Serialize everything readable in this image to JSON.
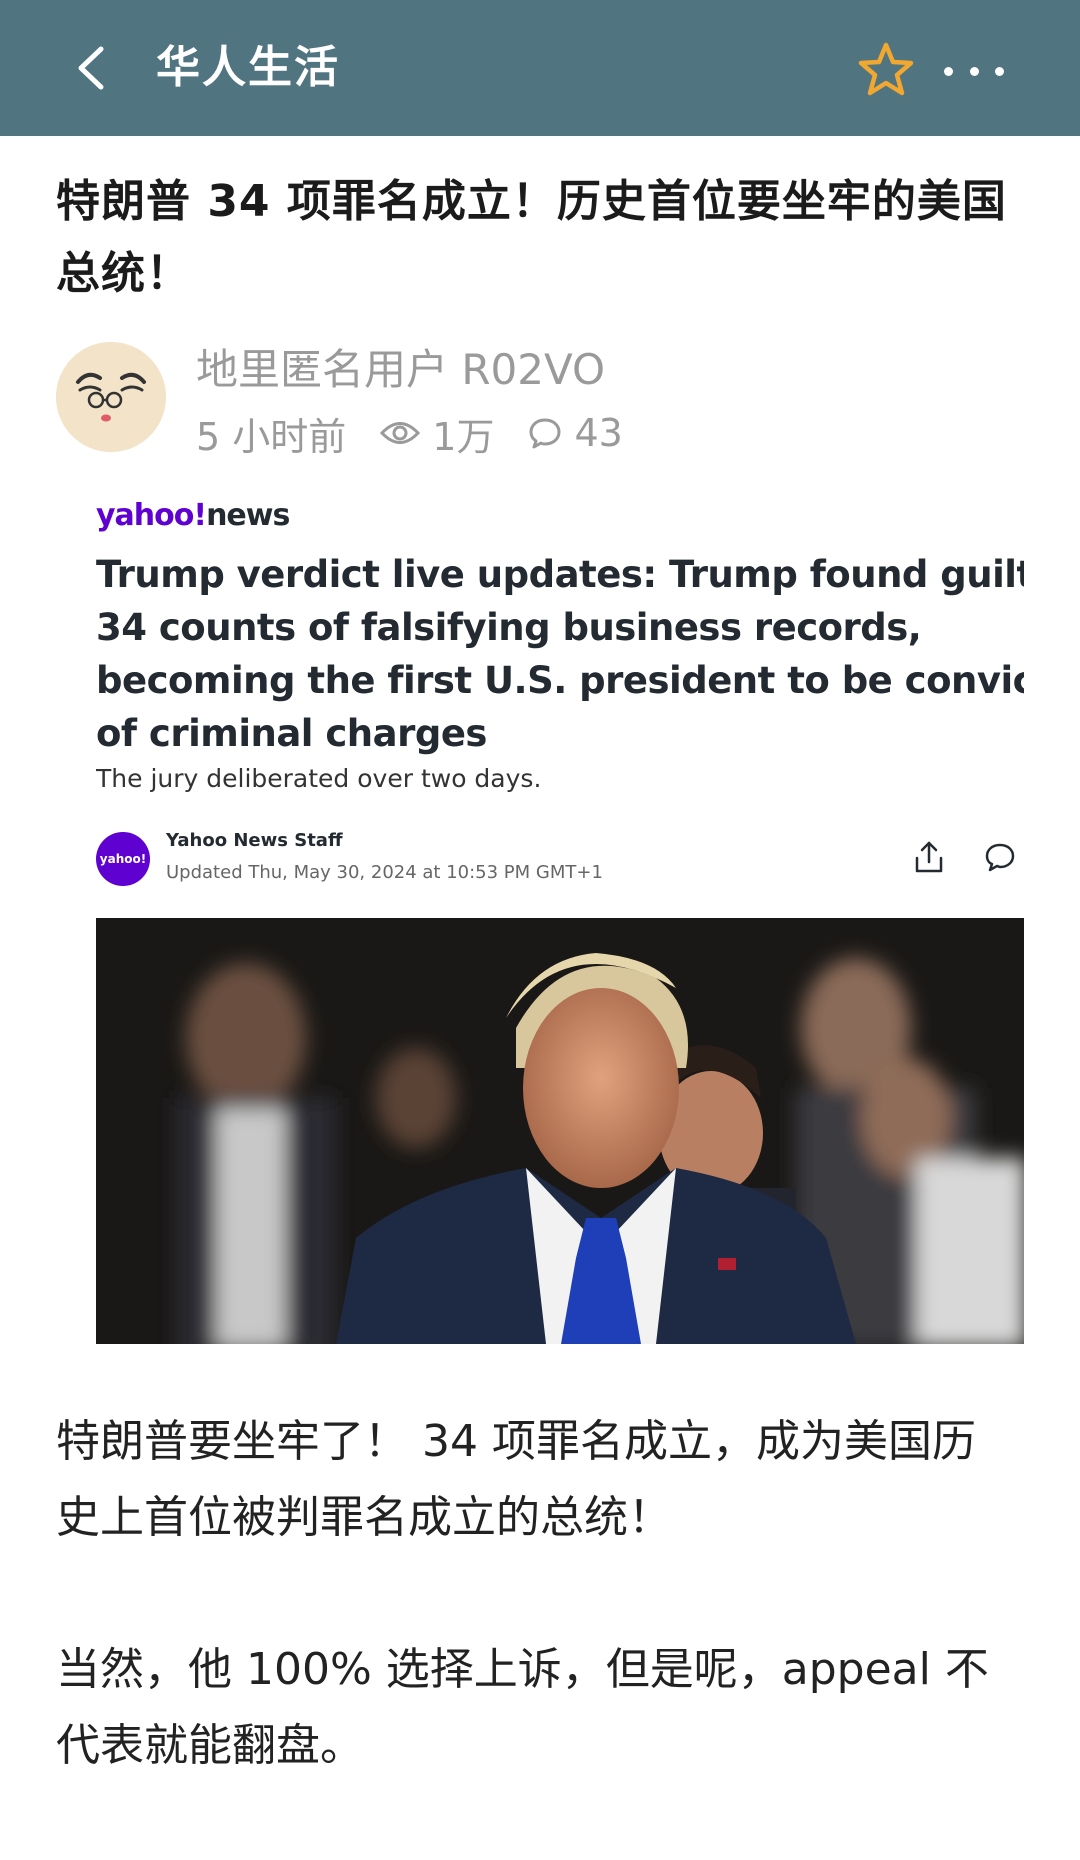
{
  "header": {
    "title": "华人生活",
    "back_icon": "chevron-left-icon",
    "favorite_icon": "star-icon",
    "more_icon": "more-dots-icon",
    "background": "#507480",
    "star_color": "#f0a830"
  },
  "post": {
    "title": "特朗普 34 项罪名成立！历史首位要坐牢的美国总统！",
    "author": "地里匿名用户 R02VO",
    "time": "5 小时前",
    "views": "1万",
    "comments": "43"
  },
  "news_card": {
    "logo_brand": "yahoo!",
    "logo_word": "news",
    "headline_lines": [
      "Trump verdict live updates: Trump found guilty",
      "34 counts of falsifying business records,",
      "becoming the first U.S. president to be convicte",
      "of criminal charges"
    ],
    "subhead": "The jury deliberated over two days.",
    "byline_logo": "yahoo!",
    "byline_name": "Yahoo News Staff",
    "byline_date": "Updated Thu, May 30, 2024 at 10:53 PM GMT+1",
    "brand_color": "#5f01d1"
  },
  "body": {
    "paragraphs": [
      "特朗普要坐牢了！ 34 项罪名成立，成为美国历史上首位被判罪名成立的总统！",
      "当然，他 100% 选择上诉，但是呢，appeal 不代表就能翻盘。"
    ]
  }
}
